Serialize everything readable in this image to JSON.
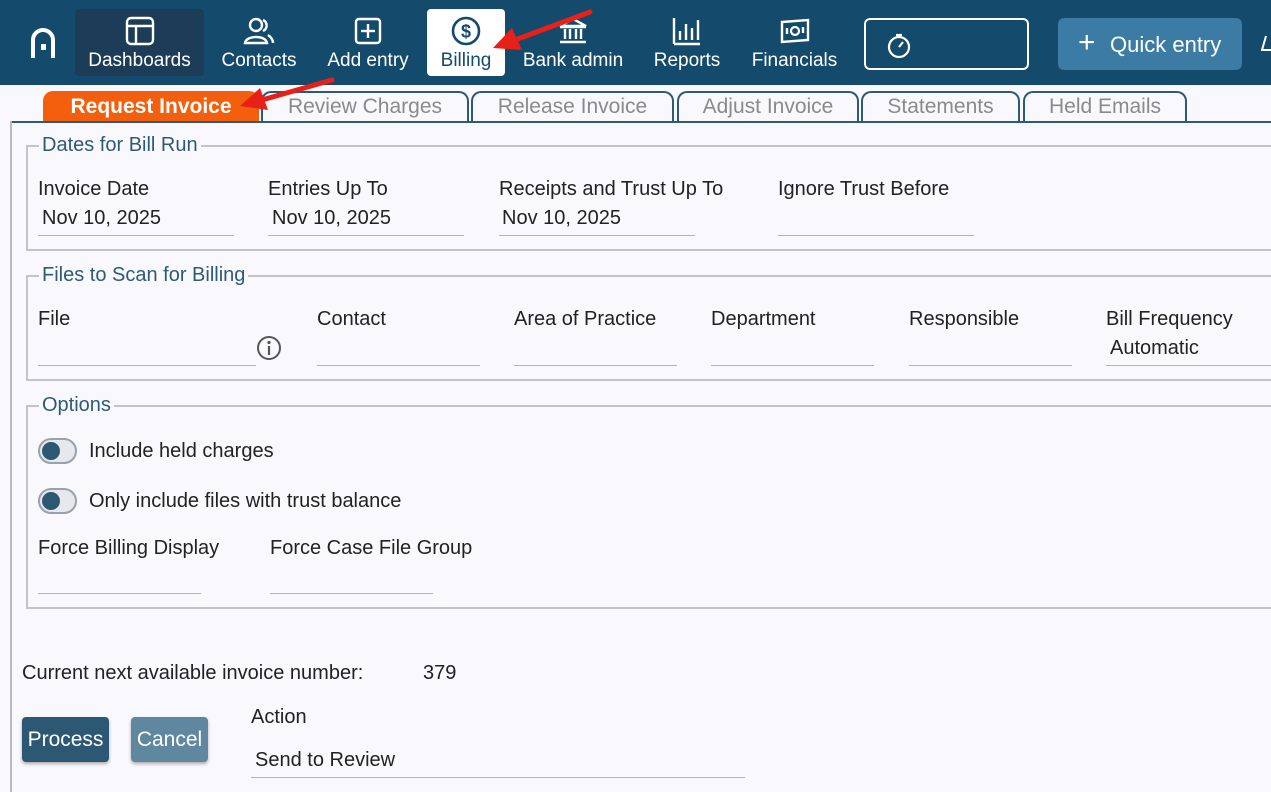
{
  "nav": {
    "items": [
      {
        "label": "Dashboards",
        "icon": "dashboard-icon"
      },
      {
        "label": "Contacts",
        "icon": "contacts-icon"
      },
      {
        "label": "Add entry",
        "icon": "add-entry-icon"
      },
      {
        "label": "Billing",
        "icon": "billing-icon"
      },
      {
        "label": "Bank admin",
        "icon": "bank-icon"
      },
      {
        "label": "Reports",
        "icon": "reports-icon"
      },
      {
        "label": "Financials",
        "icon": "financials-icon"
      }
    ],
    "active": "Billing",
    "quick_entry_label": "Quick entry"
  },
  "tabs": [
    {
      "label": "Request Invoice",
      "active": true
    },
    {
      "label": "Review Charges",
      "active": false
    },
    {
      "label": "Release Invoice",
      "active": false
    },
    {
      "label": "Adjust Invoice",
      "active": false
    },
    {
      "label": "Statements",
      "active": false
    },
    {
      "label": "Held Emails",
      "active": false
    }
  ],
  "dates": {
    "legend": "Dates for Bill Run",
    "invoice_date": {
      "label": "Invoice Date",
      "value": "Nov 10, 2025"
    },
    "entries_up_to": {
      "label": "Entries Up To",
      "value": "Nov 10, 2025"
    },
    "receipts_trust_up_to": {
      "label": "Receipts and Trust Up To",
      "value": "Nov 10, 2025"
    },
    "ignore_trust_before": {
      "label": "Ignore Trust Before",
      "value": ""
    }
  },
  "files": {
    "legend": "Files to Scan for Billing",
    "file": {
      "label": "File",
      "value": ""
    },
    "contact": {
      "label": "Contact",
      "value": ""
    },
    "area_of_practice": {
      "label": "Area of Practice",
      "value": ""
    },
    "department": {
      "label": "Department",
      "value": ""
    },
    "responsible": {
      "label": "Responsible",
      "value": ""
    },
    "bill_frequency": {
      "label": "Bill Frequency",
      "value": "Automatic"
    }
  },
  "options": {
    "legend": "Options",
    "include_held_charges": {
      "label": "Include held charges",
      "on": false
    },
    "only_trust_balance": {
      "label": "Only include files with trust balance",
      "on": false
    },
    "force_billing_display": {
      "label": "Force Billing Display",
      "value": ""
    },
    "force_case_file_group": {
      "label": "Force Case File Group",
      "value": ""
    }
  },
  "footer": {
    "next_invoice_label": "Current next available invoice number:",
    "next_invoice_number": "379",
    "process_label": "Process",
    "cancel_label": "Cancel",
    "action_label": "Action",
    "action_value": "Send to Review"
  },
  "colors": {
    "topbar": "#144a6c",
    "active_tab": "#f45f0d",
    "accent": "#2e5a78",
    "annotation_arrow": "#e8201a"
  }
}
